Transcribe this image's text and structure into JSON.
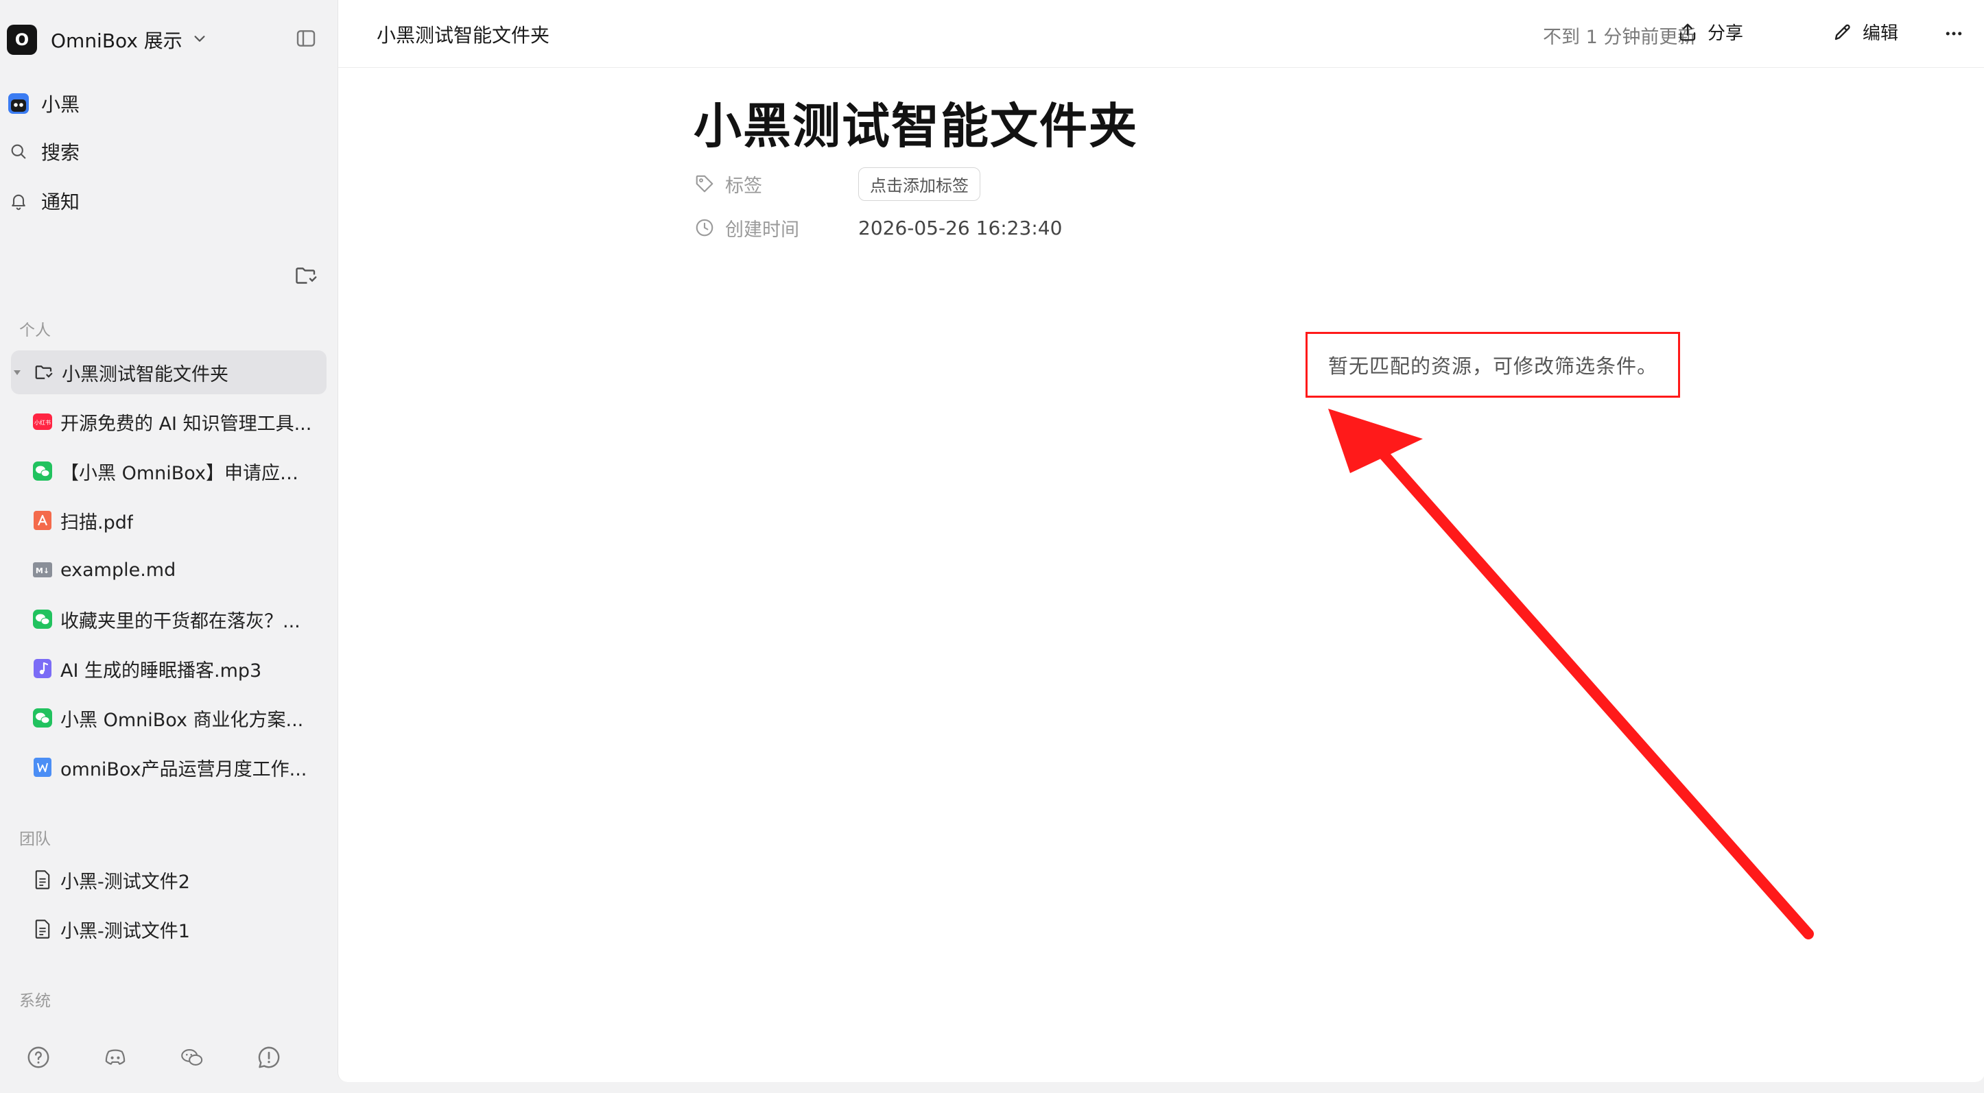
{
  "workspace": {
    "logo_letter": "O",
    "name": "OmniBox 展示"
  },
  "nav": [
    {
      "label": "小黑",
      "icon": "ninja-avatar-icon"
    },
    {
      "label": "搜索",
      "icon": "search-icon"
    },
    {
      "label": "通知",
      "icon": "bell-icon"
    }
  ],
  "sections": {
    "personal": "个人",
    "team": "团队",
    "system": "系统"
  },
  "personal": {
    "folder": {
      "label": "小黑测试智能文件夹",
      "icon": "smart-folder-icon"
    },
    "items": [
      {
        "label": "开源免费的 AI 知识管理工具...",
        "icon": "xiaohongshu-icon",
        "color": "#ff2442"
      },
      {
        "label": "【小黑 OmniBox】申请应聘...",
        "icon": "wechat-icon",
        "color": "#21c25e"
      },
      {
        "label": "扫描.pdf",
        "icon": "pdf-icon",
        "color": "#f46a4b"
      },
      {
        "label": "example.md",
        "icon": "markdown-icon",
        "color": "#8a8f98"
      },
      {
        "label": "收藏夹里的干货都在落灰？...",
        "icon": "wechat-icon",
        "color": "#21c25e"
      },
      {
        "label": "AI 生成的睡眠播客.mp3",
        "icon": "audio-icon",
        "color": "#7b6cf6"
      },
      {
        "label": "小黑 OmniBox 商业化方案...",
        "icon": "wechat-icon",
        "color": "#21c25e"
      },
      {
        "label": "omniBox产品运营月度工作...",
        "icon": "word-icon",
        "color": "#4b8ef5"
      }
    ]
  },
  "team": {
    "items": [
      {
        "label": "小黑-测试文件2",
        "icon": "document-icon"
      },
      {
        "label": "小黑-测试文件1",
        "icon": "document-icon"
      }
    ]
  },
  "footer_icons": [
    "help-icon",
    "discord-icon",
    "wechat-community-icon",
    "feedback-icon"
  ],
  "header": {
    "breadcrumb": "小黑测试智能文件夹",
    "updated": "不到 1 分钟前更新",
    "share": "分享",
    "edit": "编辑"
  },
  "page": {
    "title": "小黑测试智能文件夹",
    "tags_label": "标签",
    "tags_button": "点击添加标签",
    "created_label": "创建时间",
    "created_value": "2026-05-26 16:23:40",
    "empty_message": "暂无匹配的资源，可修改筛选条件。"
  },
  "annotation": {
    "color": "#ff1a1a"
  }
}
